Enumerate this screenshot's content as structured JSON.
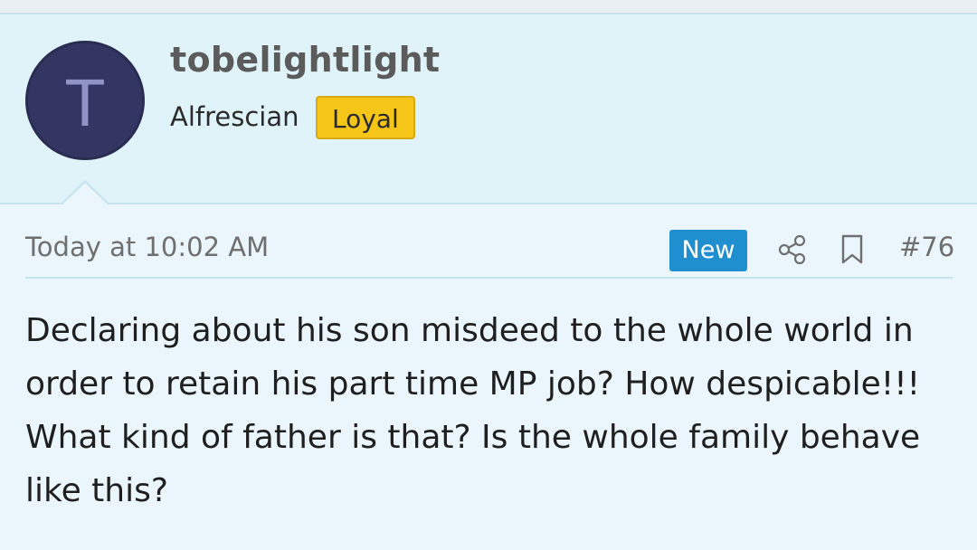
{
  "user": {
    "avatar_letter": "T",
    "username": "tobelightlight",
    "title": "Alfrescian",
    "badge": "Loyal"
  },
  "post": {
    "timestamp": "Today at 10:02 AM",
    "new_label": "New",
    "number": "#76",
    "body": "Declaring about his son misdeed to the whole world in order to retain his part time MP job? How despicable!!! What kind of father is that? Is the whole family behave like this?"
  },
  "icons": {
    "share": "share-icon",
    "bookmark": "bookmark-icon"
  },
  "colors": {
    "header_bg": "#dff3f9",
    "body_bg": "#eaf6fb",
    "avatar_bg": "#333663",
    "badge_bg": "#f5c518",
    "new_badge_bg": "#1f8fd0"
  }
}
